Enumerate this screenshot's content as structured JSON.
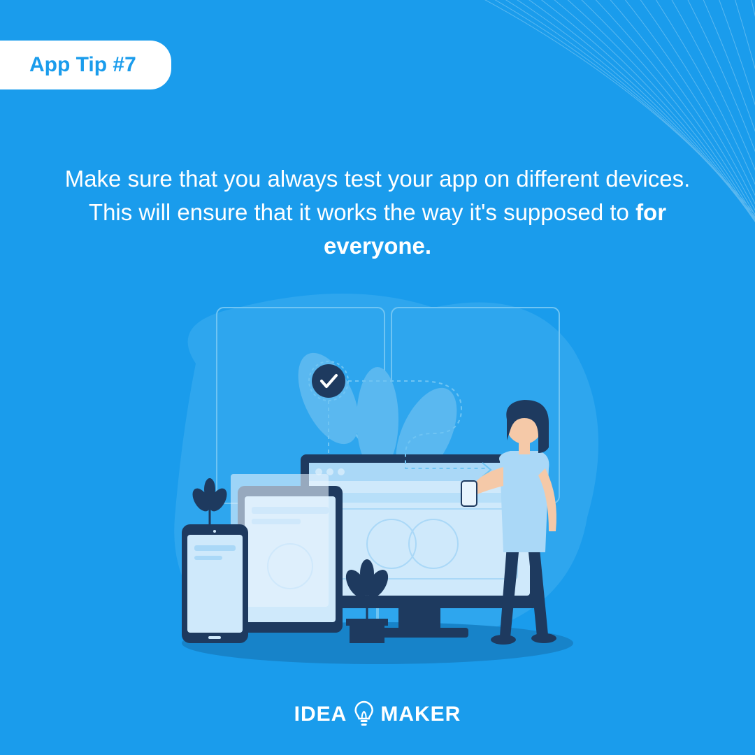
{
  "badge": {
    "label": "App Tip #7"
  },
  "tip": {
    "line_prefix": "Make sure that you always test your app on different devices. This will ensure that it works the way it's supposed to ",
    "line_bold": "for everyone."
  },
  "logo": {
    "left": "IDEA",
    "right": "MAKER"
  },
  "colors": {
    "bg": "#1a9cec",
    "accent_dark": "#1e3a5f",
    "light": "#cfe9fb",
    "white": "#ffffff"
  }
}
